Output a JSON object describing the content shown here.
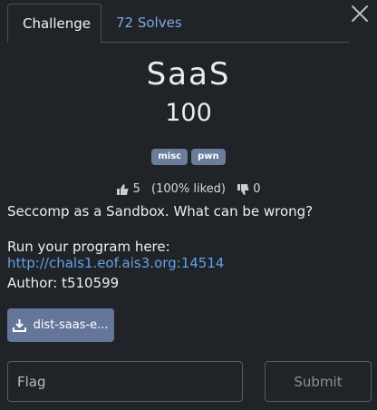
{
  "tabs": {
    "challenge": "Challenge",
    "solves": "72 Solves"
  },
  "challenge": {
    "name": "SaaS",
    "value": "100",
    "tags": [
      "misc",
      "pwn"
    ]
  },
  "votes": {
    "likes": "5",
    "percent": "(100% liked)",
    "dislikes": "0"
  },
  "description": {
    "line1": "Seccomp as a Sandbox. What can be wrong?",
    "run_prefix": "Run your program here: ",
    "run_link": "http://chals1.eof.ais3.org:14514",
    "author": "Author: t510599"
  },
  "file_button": {
    "label": "dist-saas-e..."
  },
  "flag_form": {
    "placeholder": "Flag",
    "submit_label": "Submit"
  },
  "icons": {
    "close": "close-icon",
    "like": "thumbs-up-icon",
    "dislike": "thumbs-down-icon",
    "download": "download-icon"
  }
}
